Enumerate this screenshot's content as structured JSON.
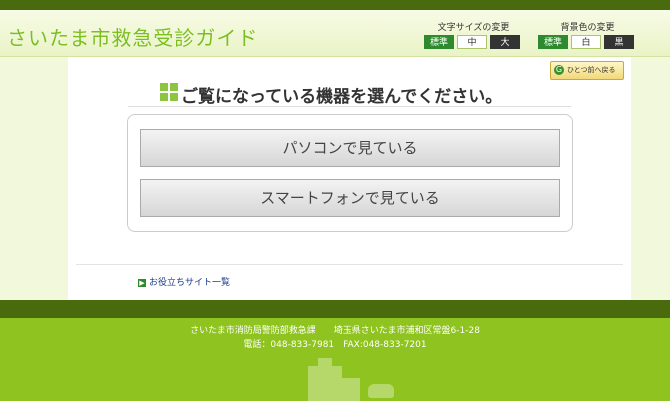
{
  "header": {
    "site_title": "さいたま市救急受診ガイド",
    "font_size": {
      "label": "文字サイズの変更",
      "options": [
        "標準",
        "中",
        "大"
      ]
    },
    "bg_color": {
      "label": "背景色の変更",
      "options": [
        "標準",
        "白",
        "黒"
      ]
    }
  },
  "main": {
    "back_label": "ひとつ前へ戻る",
    "heading": "ご覧になっている機器を選んでください。",
    "choices": [
      "パソコンで見ている",
      "スマートフォンで見ている"
    ],
    "useful_link": "お役立ちサイト一覧"
  },
  "footer": {
    "line1": "さいたま市消防局警防部救急課　　埼玉県さいたま市浦和区常盤6-1-28",
    "line2": "電話：048-833-7981　FAX:048-833-7201"
  },
  "colors": {
    "accent_green": "#8fc31f",
    "dark_green": "#4a6a0e",
    "active_button": "#2f8a2f"
  }
}
